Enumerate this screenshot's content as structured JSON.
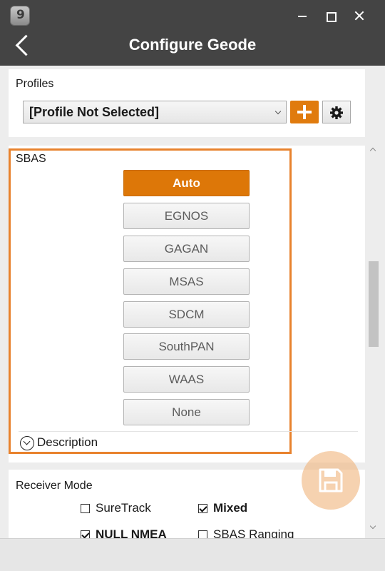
{
  "window": {
    "title": "Configure Geode",
    "app_badge": "9"
  },
  "profiles": {
    "label": "Profiles",
    "selected": "[Profile Not Selected]"
  },
  "sbas": {
    "label": "SBAS",
    "options": [
      "Auto",
      "EGNOS",
      "GAGAN",
      "MSAS",
      "SDCM",
      "SouthPAN",
      "WAAS",
      "None"
    ],
    "selected": "Auto",
    "description_label": "Description"
  },
  "receiver_mode": {
    "label": "Receiver Mode",
    "options": [
      {
        "label": "SureTrack",
        "checked": false
      },
      {
        "label": "Mixed",
        "checked": true
      },
      {
        "label": "NULL NMEA",
        "checked": true
      },
      {
        "label": "SBAS Ranging",
        "checked": false
      }
    ]
  },
  "colors": {
    "accent": "#dd7708",
    "titlebar": "#444444",
    "highlight": "#e8822d"
  }
}
